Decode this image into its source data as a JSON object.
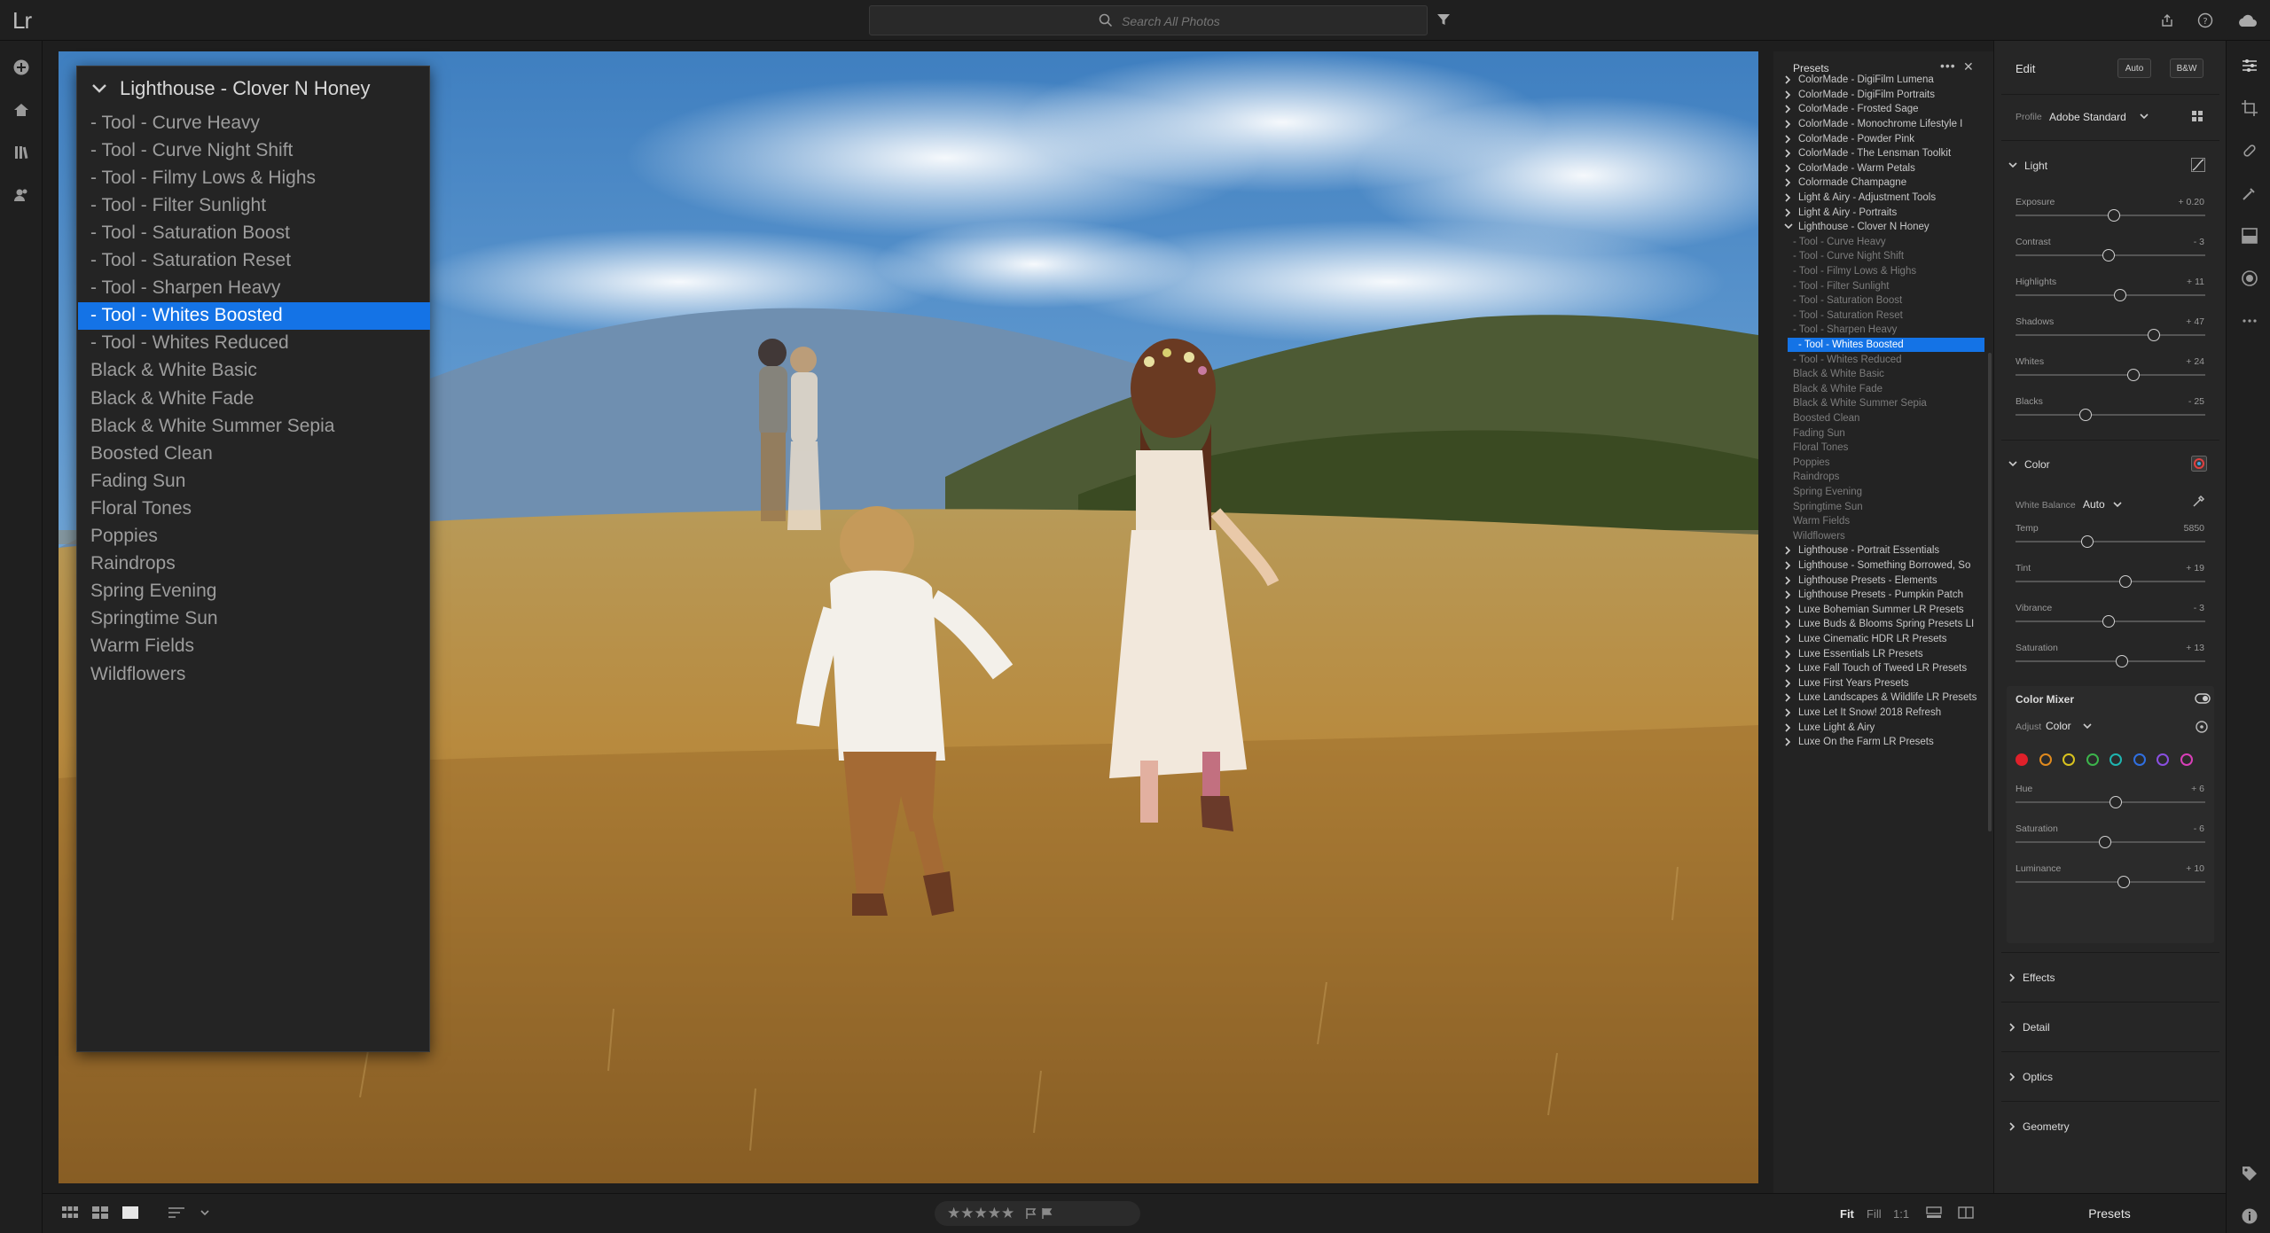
{
  "app": {
    "logo": "Lr"
  },
  "search": {
    "placeholder": "Search All Photos"
  },
  "dropdown": {
    "header": "Lighthouse - Clover N Honey",
    "items": [
      "- Tool - Curve Heavy",
      "- Tool - Curve Night Shift",
      "- Tool - Filmy Lows & Highs",
      "- Tool - Filter Sunlight",
      "- Tool - Saturation Boost",
      "- Tool - Saturation Reset",
      "- Tool - Sharpen Heavy",
      "- Tool - Whites Boosted",
      "- Tool - Whites Reduced",
      "Black & White Basic",
      "Black & White Fade",
      "Black & White Summer Sepia",
      "Boosted Clean",
      "Fading Sun",
      "Floral Tones",
      "Poppies",
      "Raindrops",
      "Spring Evening",
      "Springtime Sun",
      "Warm Fields",
      "Wildflowers"
    ],
    "selected_index": 7
  },
  "presets": {
    "title": "Presets",
    "more_label": "•••",
    "close_label": "✕",
    "groups_top": [
      "ColorMade - DigiFilm Lumena",
      "ColorMade - DigiFilm Portraits",
      "ColorMade - Frosted Sage",
      "ColorMade - Monochrome Lifestyle I",
      "ColorMade - Powder Pink",
      "ColorMade - The Lensman Toolkit",
      "ColorMade - Warm Petals",
      "Colormade Champagne",
      "Light & Airy - Adjustment Tools",
      "Light & Airy - Portraits"
    ],
    "open_group": "Lighthouse - Clover N Honey",
    "children": [
      "- Tool - Curve Heavy",
      "- Tool - Curve Night Shift",
      "- Tool - Filmy Lows & Highs",
      "- Tool - Filter Sunlight",
      "- Tool - Saturation Boost",
      "- Tool - Saturation Reset",
      "- Tool - Sharpen Heavy",
      "- Tool - Whites Boosted",
      "- Tool - Whites Reduced",
      "Black & White Basic",
      "Black & White Fade",
      "Black & White Summer Sepia",
      "Boosted Clean",
      "Fading Sun",
      "Floral Tones",
      "Poppies",
      "Raindrops",
      "Spring Evening",
      "Springtime Sun",
      "Warm Fields",
      "Wildflowers"
    ],
    "selected_child_index": 7,
    "groups_bottom": [
      "Lighthouse - Portrait Essentials",
      "Lighthouse - Something Borrowed, So",
      "Lighthouse Presets - Elements",
      "Lighthouse Presets - Pumpkin Patch",
      "Luxe Bohemian Summer LR Presets",
      "Luxe Buds & Blooms Spring Presets LI",
      "Luxe Cinematic HDR LR Presets",
      "Luxe Essentials LR Presets",
      "Luxe Fall Touch of Tweed LR Presets",
      "Luxe First Years Presets",
      "Luxe Landscapes & Wildlife LR Presets",
      "Luxe Let It Snow! 2018 Refresh",
      "Luxe Light & Airy",
      "Luxe On the Farm LR Presets"
    ]
  },
  "edit": {
    "title": "Edit",
    "auto_label": "Auto",
    "bw_label": "B&W",
    "profile_label": "Profile",
    "profile_value": "Adobe Standard",
    "light": {
      "title": "Light",
      "sliders": [
        {
          "label": "Exposure",
          "value": "+ 0.20",
          "pos": 0.52
        },
        {
          "label": "Contrast",
          "value": "- 3",
          "pos": 0.49
        },
        {
          "label": "Highlights",
          "value": "+ 11",
          "pos": 0.55
        },
        {
          "label": "Shadows",
          "value": "+ 47",
          "pos": 0.73
        },
        {
          "label": "Whites",
          "value": "+ 24",
          "pos": 0.62
        },
        {
          "label": "Blacks",
          "value": "- 25",
          "pos": 0.37
        }
      ]
    },
    "color": {
      "title": "Color",
      "wb_label": "White Balance",
      "wb_value": "Auto",
      "sliders": [
        {
          "label": "Temp",
          "value": "5850",
          "pos": 0.38
        },
        {
          "label": "Tint",
          "value": "+ 19",
          "pos": 0.58
        },
        {
          "label": "Vibrance",
          "value": "- 3",
          "pos": 0.49
        },
        {
          "label": "Saturation",
          "value": "+ 13",
          "pos": 0.56
        }
      ]
    },
    "mixer": {
      "title": "Color Mixer",
      "adjust_label": "Adjust",
      "adjust_value": "Color",
      "swatches": [
        "#e0202a",
        "#e08a1e",
        "#d8c21e",
        "#3cb44b",
        "#1fb5b0",
        "#2f6fe0",
        "#8a4fe0",
        "#d83fb8"
      ],
      "sliders": [
        {
          "label": "Hue",
          "value": "+ 6",
          "pos": 0.53
        },
        {
          "label": "Saturation",
          "value": "- 6",
          "pos": 0.47
        },
        {
          "label": "Luminance",
          "value": "+ 10",
          "pos": 0.57
        }
      ]
    },
    "collapsed": [
      "Effects",
      "Detail",
      "Optics",
      "Geometry"
    ]
  },
  "bottom": {
    "stars": "★★★★★",
    "fit": "Fit",
    "fill": "Fill",
    "one_to_one": "1:1",
    "presets_tab": "Presets"
  }
}
